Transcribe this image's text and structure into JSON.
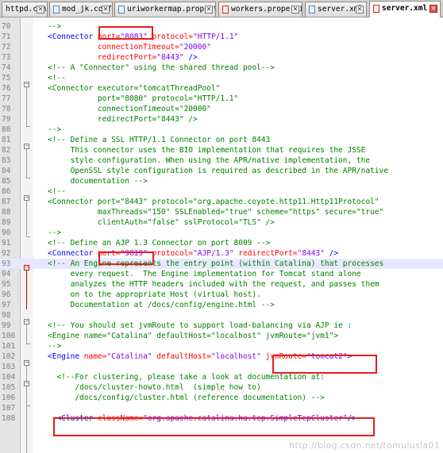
{
  "tabs": [
    {
      "label": "httpd.conf",
      "icon": "file-icon"
    },
    {
      "label": "mod_jk.conf",
      "icon": "file-icon"
    },
    {
      "label": "uriworkermap.properties",
      "icon": "file-icon"
    },
    {
      "label": "workers.properties",
      "icon": "file-icon"
    },
    {
      "label": "server.xml",
      "icon": "file-icon"
    },
    {
      "label": "server.xml",
      "icon": "file-icon",
      "active": true
    }
  ],
  "editor": {
    "lines": [
      {
        "n": "70",
        "t": [
          [
            "cmt",
            "-->"
          ]
        ]
      },
      {
        "n": "71",
        "t": [
          [
            "tag",
            "<Connector "
          ],
          [
            "attr",
            "port="
          ],
          [
            "val",
            "\"8083\""
          ],
          [
            "attr",
            " protocol="
          ],
          [
            "val",
            "\"HTTP/1.1\""
          ]
        ]
      },
      {
        "n": "72",
        "t": [
          [
            "attr",
            "           connectionTimeout="
          ],
          [
            "val",
            "\"20000\""
          ]
        ]
      },
      {
        "n": "73",
        "t": [
          [
            "attr",
            "           redirectPort="
          ],
          [
            "val",
            "\"8443\""
          ],
          [
            "tag",
            " />"
          ]
        ]
      },
      {
        "n": "74",
        "t": [
          [
            "cmt",
            "<!-- A \"Connector\" using the shared thread pool-->"
          ]
        ]
      },
      {
        "n": "75",
        "t": [
          [
            "cmt",
            "<!--"
          ]
        ]
      },
      {
        "n": "76",
        "t": [
          [
            "cmt",
            "<Connector executor=\"tomcatThreadPool\""
          ]
        ]
      },
      {
        "n": "77",
        "t": [
          [
            "cmt",
            "           port=\"8080\" protocol=\"HTTP/1.1\""
          ]
        ]
      },
      {
        "n": "78",
        "t": [
          [
            "cmt",
            "           connectionTimeout=\"20000\""
          ]
        ]
      },
      {
        "n": "79",
        "t": [
          [
            "cmt",
            "           redirectPort=\"8443\" />"
          ]
        ]
      },
      {
        "n": "80",
        "t": [
          [
            "cmt",
            "-->"
          ]
        ]
      },
      {
        "n": "81",
        "t": [
          [
            "cmt",
            "<!-- Define a SSL HTTP/1.1 Connector on port 8443"
          ]
        ]
      },
      {
        "n": "82",
        "t": [
          [
            "cmt",
            "     This connector uses the BIO implementation that requires the JSSE"
          ]
        ]
      },
      {
        "n": "83",
        "t": [
          [
            "cmt",
            "     style configuration. When using the APR/native implementation, the"
          ]
        ]
      },
      {
        "n": "84",
        "t": [
          [
            "cmt",
            "     OpenSSL style configuration is required as described in the APR/native"
          ]
        ]
      },
      {
        "n": "85",
        "t": [
          [
            "cmt",
            "     documentation -->"
          ]
        ]
      },
      {
        "n": "86",
        "t": [
          [
            "cmt",
            "<!--"
          ]
        ]
      },
      {
        "n": "87",
        "t": [
          [
            "cmt",
            "<Connector port=\"8443\" protocol=\"org.apache.coyote.http11.Http11Protocol\""
          ]
        ]
      },
      {
        "n": "88",
        "t": [
          [
            "cmt",
            "           maxThreads=\"150\" SSLEnabled=\"true\" scheme=\"https\" secure=\"true\""
          ]
        ]
      },
      {
        "n": "89",
        "t": [
          [
            "cmt",
            "           clientAuth=\"false\" sslProtocol=\"TLS\" />"
          ]
        ]
      },
      {
        "n": "90",
        "t": [
          [
            "cmt",
            "-->"
          ]
        ]
      },
      {
        "n": "91",
        "t": [
          [
            "cmt",
            "<!-- Define an AJP 1.3 Connector on port 8009 -->"
          ]
        ]
      },
      {
        "n": "92",
        "t": [
          [
            "tag",
            "<Connector "
          ],
          [
            "attr",
            "port="
          ],
          [
            "val",
            "\"9019\""
          ],
          [
            "attr",
            " protocol="
          ],
          [
            "val",
            "\"AJP/1.3\""
          ],
          [
            "attr",
            " redirectPort="
          ],
          [
            "val",
            "\"8443\""
          ],
          [
            "tag",
            " />"
          ]
        ]
      },
      {
        "n": "93",
        "t": [
          [
            "cmt",
            "<!-- An Engine represents the entry point (within Catalina) that processes"
          ]
        ],
        "current": true
      },
      {
        "n": "94",
        "t": [
          [
            "cmt",
            "     every request.  The Engine implementation for Tomcat stand alone"
          ]
        ]
      },
      {
        "n": "95",
        "t": [
          [
            "cmt",
            "     analyzes the HTTP headers included with the request, and passes them"
          ]
        ]
      },
      {
        "n": "96",
        "t": [
          [
            "cmt",
            "     on to the appropriate Host (virtual host)."
          ]
        ]
      },
      {
        "n": "97",
        "t": [
          [
            "cmt",
            "     Documentation at /docs/config/engine.html -->"
          ]
        ]
      },
      {
        "n": "98",
        "t": [
          [
            "cmt",
            ""
          ]
        ]
      },
      {
        "n": "99",
        "t": [
          [
            "cmt",
            "<!-- You should set jvmRoute to support load-balancing via AJP ie :"
          ]
        ]
      },
      {
        "n": "100",
        "t": [
          [
            "cmt",
            "<Engine name=\"Catalina\" defaultHost=\"localhost\" jvmRoute=\"jvm1\">"
          ]
        ]
      },
      {
        "n": "101",
        "t": [
          [
            "cmt",
            "-->"
          ]
        ]
      },
      {
        "n": "102",
        "t": [
          [
            "tag",
            "<Engine "
          ],
          [
            "attr",
            "name="
          ],
          [
            "val",
            "\"Catalina\""
          ],
          [
            "attr",
            " defaultHost="
          ],
          [
            "val",
            "\"localhost\""
          ],
          [
            "attr",
            " jvmRoute="
          ],
          [
            "val",
            "\"tomcat2\""
          ],
          [
            "tag",
            ">"
          ]
        ]
      },
      {
        "n": "103",
        "t": [
          [
            "cmt",
            ""
          ]
        ]
      },
      {
        "n": "104",
        "t": [
          [
            "cmt",
            "  <!--For clustering, please take a look at documentation at:"
          ]
        ]
      },
      {
        "n": "105",
        "t": [
          [
            "cmt",
            "      /docs/cluster-howto.html  (simple how to)"
          ]
        ]
      },
      {
        "n": "106",
        "t": [
          [
            "cmt",
            "      /docs/config/cluster.html (reference documentation) -->"
          ]
        ]
      },
      {
        "n": "107",
        "t": [
          [
            "cmt",
            ""
          ]
        ]
      },
      {
        "n": "108",
        "t": [
          [
            "tag",
            "  <Cluster "
          ],
          [
            "attr",
            "className="
          ],
          [
            "val",
            "\"org.apache.catalina.ha.tcp.SimpleTcpCluster\""
          ],
          [
            "tag",
            "/>"
          ]
        ]
      }
    ]
  },
  "watermark": "http://blog.csdn.net/tomulusla01"
}
